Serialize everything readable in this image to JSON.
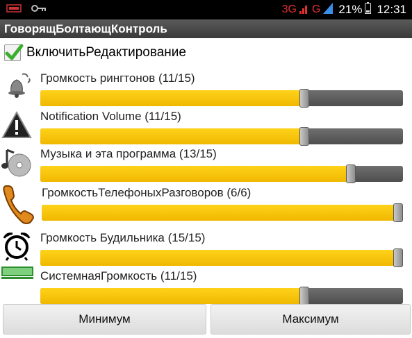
{
  "statusbar": {
    "network_3g": "3G",
    "network_g": "G",
    "battery_percent": "21%",
    "time": "12:31"
  },
  "app": {
    "title": "ГоворящБолтающКонтроль"
  },
  "enable_editing": {
    "label": "ВключитьРедактирование",
    "checked": true
  },
  "sliders": [
    {
      "label": "Громкость рингтонов (11/15)",
      "value": 11,
      "max": 15,
      "icon": "bell-icon"
    },
    {
      "label": "Notification Volume (11/15)",
      "value": 11,
      "max": 15,
      "icon": "warning-icon"
    },
    {
      "label": "Музыка и эта программа (13/15)",
      "value": 13,
      "max": 15,
      "icon": "music-cd-icon"
    },
    {
      "label": "ГромкостьТелефоныхРазговоров (6/6)",
      "value": 6,
      "max": 6,
      "icon": "phone-handset-icon"
    },
    {
      "label": "Громкость Будильника (15/15)",
      "value": 15,
      "max": 15,
      "icon": "alarm-clock-icon"
    },
    {
      "label": "СистемнаяГромкость (11/15)",
      "value": 11,
      "max": 15,
      "icon": "system-logo-icon"
    }
  ],
  "buttons": {
    "min_label": "Минимум",
    "max_label": "Максимум"
  },
  "colors": {
    "fill": "#f5c400",
    "track": "#5a5a5a",
    "titlebar": "#4a4a4a"
  }
}
